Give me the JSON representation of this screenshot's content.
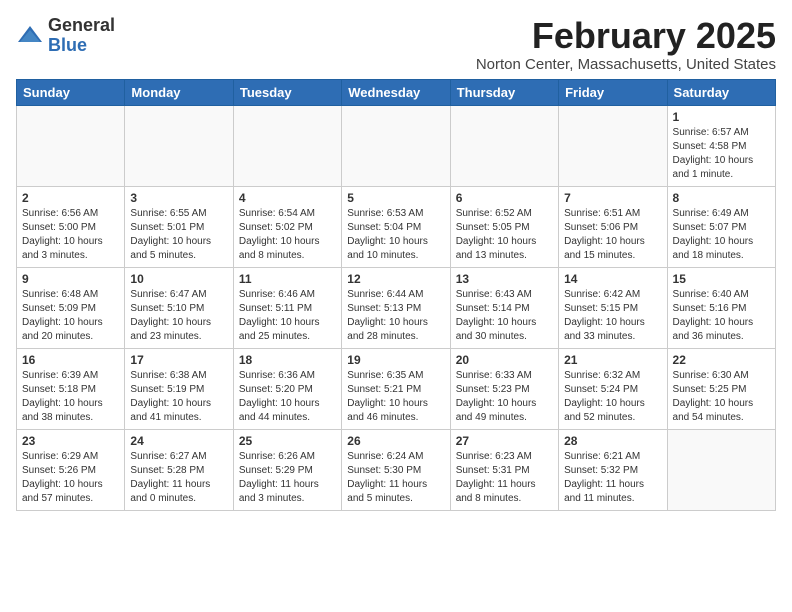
{
  "header": {
    "logo_general": "General",
    "logo_blue": "Blue",
    "month_title": "February 2025",
    "location": "Norton Center, Massachusetts, United States"
  },
  "weekdays": [
    "Sunday",
    "Monday",
    "Tuesday",
    "Wednesday",
    "Thursday",
    "Friday",
    "Saturday"
  ],
  "weeks": [
    [
      {
        "day": "",
        "info": ""
      },
      {
        "day": "",
        "info": ""
      },
      {
        "day": "",
        "info": ""
      },
      {
        "day": "",
        "info": ""
      },
      {
        "day": "",
        "info": ""
      },
      {
        "day": "",
        "info": ""
      },
      {
        "day": "1",
        "info": "Sunrise: 6:57 AM\nSunset: 4:58 PM\nDaylight: 10 hours and 1 minute."
      }
    ],
    [
      {
        "day": "2",
        "info": "Sunrise: 6:56 AM\nSunset: 5:00 PM\nDaylight: 10 hours and 3 minutes."
      },
      {
        "day": "3",
        "info": "Sunrise: 6:55 AM\nSunset: 5:01 PM\nDaylight: 10 hours and 5 minutes."
      },
      {
        "day": "4",
        "info": "Sunrise: 6:54 AM\nSunset: 5:02 PM\nDaylight: 10 hours and 8 minutes."
      },
      {
        "day": "5",
        "info": "Sunrise: 6:53 AM\nSunset: 5:04 PM\nDaylight: 10 hours and 10 minutes."
      },
      {
        "day": "6",
        "info": "Sunrise: 6:52 AM\nSunset: 5:05 PM\nDaylight: 10 hours and 13 minutes."
      },
      {
        "day": "7",
        "info": "Sunrise: 6:51 AM\nSunset: 5:06 PM\nDaylight: 10 hours and 15 minutes."
      },
      {
        "day": "8",
        "info": "Sunrise: 6:49 AM\nSunset: 5:07 PM\nDaylight: 10 hours and 18 minutes."
      }
    ],
    [
      {
        "day": "9",
        "info": "Sunrise: 6:48 AM\nSunset: 5:09 PM\nDaylight: 10 hours and 20 minutes."
      },
      {
        "day": "10",
        "info": "Sunrise: 6:47 AM\nSunset: 5:10 PM\nDaylight: 10 hours and 23 minutes."
      },
      {
        "day": "11",
        "info": "Sunrise: 6:46 AM\nSunset: 5:11 PM\nDaylight: 10 hours and 25 minutes."
      },
      {
        "day": "12",
        "info": "Sunrise: 6:44 AM\nSunset: 5:13 PM\nDaylight: 10 hours and 28 minutes."
      },
      {
        "day": "13",
        "info": "Sunrise: 6:43 AM\nSunset: 5:14 PM\nDaylight: 10 hours and 30 minutes."
      },
      {
        "day": "14",
        "info": "Sunrise: 6:42 AM\nSunset: 5:15 PM\nDaylight: 10 hours and 33 minutes."
      },
      {
        "day": "15",
        "info": "Sunrise: 6:40 AM\nSunset: 5:16 PM\nDaylight: 10 hours and 36 minutes."
      }
    ],
    [
      {
        "day": "16",
        "info": "Sunrise: 6:39 AM\nSunset: 5:18 PM\nDaylight: 10 hours and 38 minutes."
      },
      {
        "day": "17",
        "info": "Sunrise: 6:38 AM\nSunset: 5:19 PM\nDaylight: 10 hours and 41 minutes."
      },
      {
        "day": "18",
        "info": "Sunrise: 6:36 AM\nSunset: 5:20 PM\nDaylight: 10 hours and 44 minutes."
      },
      {
        "day": "19",
        "info": "Sunrise: 6:35 AM\nSunset: 5:21 PM\nDaylight: 10 hours and 46 minutes."
      },
      {
        "day": "20",
        "info": "Sunrise: 6:33 AM\nSunset: 5:23 PM\nDaylight: 10 hours and 49 minutes."
      },
      {
        "day": "21",
        "info": "Sunrise: 6:32 AM\nSunset: 5:24 PM\nDaylight: 10 hours and 52 minutes."
      },
      {
        "day": "22",
        "info": "Sunrise: 6:30 AM\nSunset: 5:25 PM\nDaylight: 10 hours and 54 minutes."
      }
    ],
    [
      {
        "day": "23",
        "info": "Sunrise: 6:29 AM\nSunset: 5:26 PM\nDaylight: 10 hours and 57 minutes."
      },
      {
        "day": "24",
        "info": "Sunrise: 6:27 AM\nSunset: 5:28 PM\nDaylight: 11 hours and 0 minutes."
      },
      {
        "day": "25",
        "info": "Sunrise: 6:26 AM\nSunset: 5:29 PM\nDaylight: 11 hours and 3 minutes."
      },
      {
        "day": "26",
        "info": "Sunrise: 6:24 AM\nSunset: 5:30 PM\nDaylight: 11 hours and 5 minutes."
      },
      {
        "day": "27",
        "info": "Sunrise: 6:23 AM\nSunset: 5:31 PM\nDaylight: 11 hours and 8 minutes."
      },
      {
        "day": "28",
        "info": "Sunrise: 6:21 AM\nSunset: 5:32 PM\nDaylight: 11 hours and 11 minutes."
      },
      {
        "day": "",
        "info": ""
      }
    ]
  ]
}
